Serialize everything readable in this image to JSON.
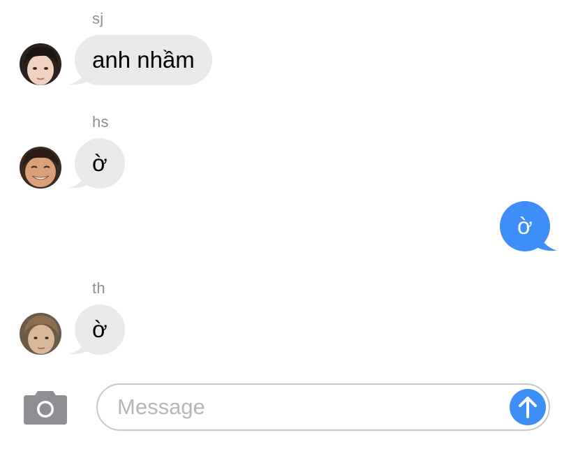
{
  "conversation": {
    "messages": [
      {
        "sender": "sj",
        "direction": "incoming",
        "text": "anh nhầm",
        "avatar": "avatar-sj"
      },
      {
        "sender": "hs",
        "direction": "incoming",
        "text": "ờ",
        "avatar": "avatar-hs"
      },
      {
        "sender": "",
        "direction": "outgoing",
        "text": "ờ"
      },
      {
        "sender": "th",
        "direction": "incoming",
        "text": "ờ",
        "avatar": "avatar-th"
      }
    ]
  },
  "composer": {
    "placeholder": "Message",
    "value": "",
    "camera_icon": "camera-icon",
    "send_icon": "arrow-up-icon"
  },
  "colors": {
    "incoming_bubble": "#e9e9eb",
    "outgoing_bubble": "#3e8ef7",
    "sender_label": "#8e8e93",
    "send_button": "#3e8ef7",
    "camera_icon": "#8e8e93"
  }
}
